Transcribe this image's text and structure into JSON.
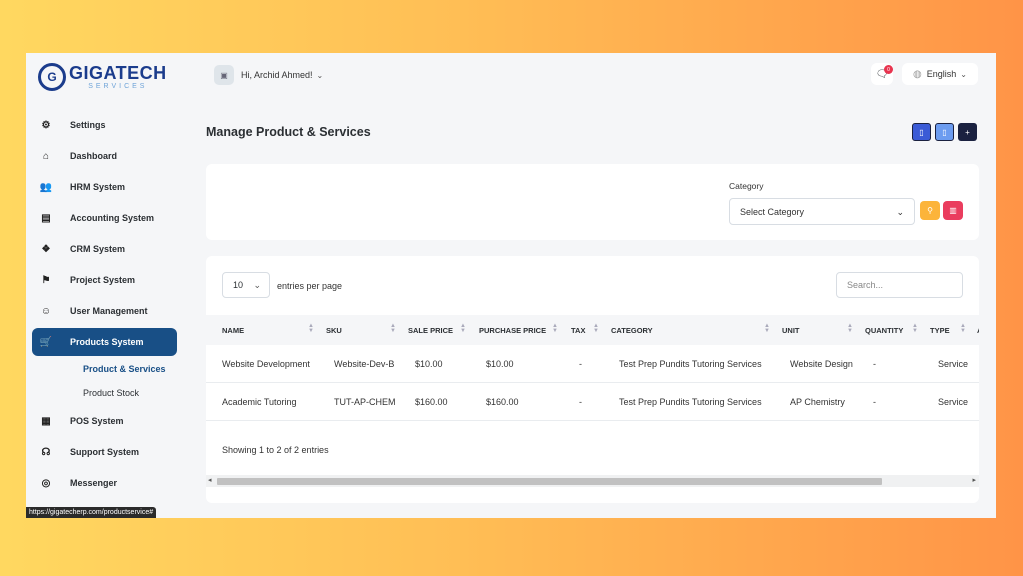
{
  "brand": {
    "mark": "G",
    "name": "GIGATECH",
    "sub": "SERVICES"
  },
  "sidebar": {
    "items": [
      {
        "label": "Settings",
        "icon": "gear-icon",
        "glyph": "⚙"
      },
      {
        "label": "Dashboard",
        "icon": "home-icon",
        "glyph": "⌂"
      },
      {
        "label": "HRM System",
        "icon": "users-icon",
        "glyph": "👥"
      },
      {
        "label": "Accounting System",
        "icon": "invoice-icon",
        "glyph": "▤"
      },
      {
        "label": "CRM System",
        "icon": "cubes-icon",
        "glyph": "❖"
      },
      {
        "label": "Project System",
        "icon": "flag-icon",
        "glyph": "⚑"
      },
      {
        "label": "User Management",
        "icon": "user-icon",
        "glyph": "☺"
      },
      {
        "label": "Products System",
        "icon": "cart-icon",
        "glyph": "🛒"
      },
      {
        "label": "POS System",
        "icon": "register-icon",
        "glyph": "▦"
      },
      {
        "label": "Support System",
        "icon": "headset-icon",
        "glyph": "☊"
      },
      {
        "label": "Messenger",
        "icon": "chat-icon",
        "glyph": "◎"
      }
    ],
    "sub_items": [
      {
        "label": "Product & Services"
      },
      {
        "label": "Product Stock"
      }
    ]
  },
  "status_bar": {
    "url": "https://gigatecherp.com/productservice#"
  },
  "header": {
    "greeting": "Hi, Archid Ahmed!",
    "notification_count": "0",
    "language": "English"
  },
  "page": {
    "title": "Manage Product & Services"
  },
  "filter": {
    "category_label": "Category",
    "category_value": "Select Category"
  },
  "table": {
    "per_page_value": "10",
    "per_page_label": "entries per page",
    "search_placeholder": "Search...",
    "columns": [
      "Name",
      "SKU",
      "Sale Price",
      "Purchase Price",
      "Tax",
      "Category",
      "Unit",
      "Quantity",
      "Type",
      "A"
    ],
    "rows": [
      {
        "name": "Website Development",
        "sku": "Website-Dev-B",
        "sale": "$10.00",
        "purchase": "$10.00",
        "tax": "-",
        "category": "Test Prep Pundits Tutoring Services",
        "unit": "Website Design",
        "qty": "-",
        "type": "Service"
      },
      {
        "name": "Academic Tutoring",
        "sku": "TUT-AP-CHEM",
        "sale": "$160.00",
        "purchase": "$160.00",
        "tax": "-",
        "category": "Test Prep Pundits Tutoring Services",
        "unit": "AP Chemistry",
        "qty": "-",
        "type": "Service"
      }
    ],
    "footer": "Showing 1 to 2 of 2 entries"
  },
  "colors": {
    "accent": "#184f86",
    "search_btn": "#fcb43a",
    "reset_btn": "#ea3d5e"
  }
}
